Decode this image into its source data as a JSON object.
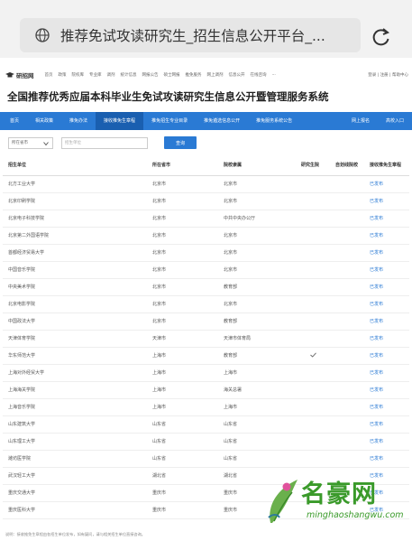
{
  "browser": {
    "url_title": "推荐免试攻读研究生_招生信息公开平台_..."
  },
  "site": {
    "logo_text": "研招网",
    "top_links": [
      "首页",
      "政策",
      "院校库",
      "专业库",
      "调剂",
      "统计信息",
      "网报公告",
      "硕士网报",
      "推免服务",
      "网上调剂",
      "信息公开",
      "在线咨询",
      "···"
    ],
    "top_right": "登录 | 注册 | 帮助中心"
  },
  "page_title": "全国推荐优秀应届本科毕业生免试攻读研究生信息公开暨管理服务系统",
  "main_nav": {
    "left": [
      "首页",
      "相关政策",
      "推免办法",
      "接收推免生章程",
      "推免招生专业目录",
      "推免遴选信息公开",
      "推免服务系统公告"
    ],
    "active_index": 3,
    "right": [
      "网上报名",
      "高校入口"
    ]
  },
  "filter": {
    "province_select": "所在省市",
    "unit_placeholder": "招生单位",
    "query_button": "查询"
  },
  "table": {
    "headers": [
      "招生单位",
      "所在省市",
      "院校隶属",
      "研究生院",
      "自划线院校",
      "接收推免生章程"
    ],
    "rows": [
      {
        "unit": "北方工业大学",
        "province": "北京市",
        "affiliation": "北京市",
        "grad_school": false,
        "self_line": false,
        "status": "已发布"
      },
      {
        "unit": "北京印刷学院",
        "province": "北京市",
        "affiliation": "北京市",
        "grad_school": false,
        "self_line": false,
        "status": "已发布"
      },
      {
        "unit": "北京电子科技学院",
        "province": "北京市",
        "affiliation": "中共中央办公厅",
        "grad_school": false,
        "self_line": false,
        "status": "已发布"
      },
      {
        "unit": "北京第二外国语学院",
        "province": "北京市",
        "affiliation": "北京市",
        "grad_school": false,
        "self_line": false,
        "status": "已发布"
      },
      {
        "unit": "首都经济贸易大学",
        "province": "北京市",
        "affiliation": "北京市",
        "grad_school": false,
        "self_line": false,
        "status": "已发布"
      },
      {
        "unit": "中国音乐学院",
        "province": "北京市",
        "affiliation": "北京市",
        "grad_school": false,
        "self_line": false,
        "status": "已发布"
      },
      {
        "unit": "中央美术学院",
        "province": "北京市",
        "affiliation": "教育部",
        "grad_school": false,
        "self_line": false,
        "status": "已发布"
      },
      {
        "unit": "北京电影学院",
        "province": "北京市",
        "affiliation": "北京市",
        "grad_school": false,
        "self_line": false,
        "status": "已发布"
      },
      {
        "unit": "中国政法大学",
        "province": "北京市",
        "affiliation": "教育部",
        "grad_school": false,
        "self_line": false,
        "status": "已发布"
      },
      {
        "unit": "天津体育学院",
        "province": "天津市",
        "affiliation": "天津市体育局",
        "grad_school": false,
        "self_line": false,
        "status": "已发布"
      },
      {
        "unit": "华东师范大学",
        "province": "上海市",
        "affiliation": "教育部",
        "grad_school": true,
        "self_line": false,
        "status": "已发布"
      },
      {
        "unit": "上海对外经贸大学",
        "province": "上海市",
        "affiliation": "上海市",
        "grad_school": false,
        "self_line": false,
        "status": "已发布"
      },
      {
        "unit": "上海海关学院",
        "province": "上海市",
        "affiliation": "海关总署",
        "grad_school": false,
        "self_line": false,
        "status": "已发布"
      },
      {
        "unit": "上海音乐学院",
        "province": "上海市",
        "affiliation": "上海市",
        "grad_school": false,
        "self_line": false,
        "status": "已发布"
      },
      {
        "unit": "山东建筑大学",
        "province": "山东省",
        "affiliation": "山东省",
        "grad_school": false,
        "self_line": false,
        "status": "已发布"
      },
      {
        "unit": "山东理工大学",
        "province": "山东省",
        "affiliation": "山东省",
        "grad_school": false,
        "self_line": false,
        "status": "已发布"
      },
      {
        "unit": "潍坊医学院",
        "province": "山东省",
        "affiliation": "山东省",
        "grad_school": false,
        "self_line": false,
        "status": "已发布"
      },
      {
        "unit": "武汉轻工大学",
        "province": "湖北省",
        "affiliation": "湖北省",
        "grad_school": false,
        "self_line": false,
        "status": "已发布"
      },
      {
        "unit": "重庆交通大学",
        "province": "重庆市",
        "affiliation": "重庆市",
        "grad_school": false,
        "self_line": false,
        "status": "已发布"
      },
      {
        "unit": "重庆医科大学",
        "province": "重庆市",
        "affiliation": "重庆市",
        "grad_school": false,
        "self_line": false,
        "status": "已发布"
      }
    ]
  },
  "footnote": "说明：接收推免生章程由各招生单位发布，如有疑问，请与相关招生单位直接咨询。",
  "watermark": {
    "name": "名豪网",
    "url": "minghaoshangwu.com"
  },
  "colors": {
    "nav_blue": "#2a7ad4",
    "nav_active": "#1a5fb0",
    "status_blue": "#2a7ad4",
    "watermark_green": "#3a9a2a"
  },
  "icons": {
    "url_bar_left": "globe-icon",
    "url_bar_right": "reload-icon",
    "site_logo": "graduation-cap-icon",
    "select_arrow": "chevron-down-icon",
    "table_mark": "checkmark-icon"
  }
}
